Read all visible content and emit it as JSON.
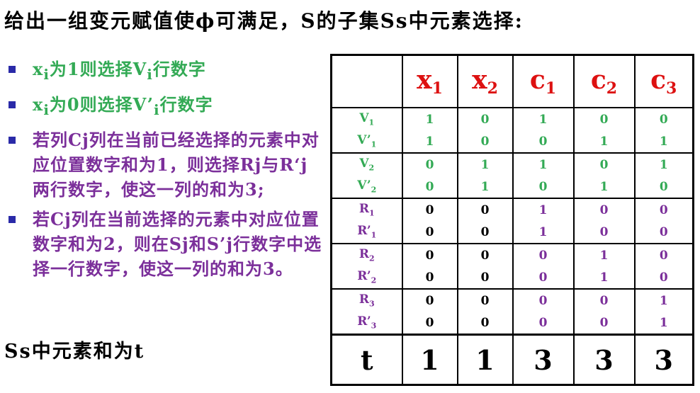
{
  "title": "给出一组变元赋值使ϕ可满足，S的子集Ss中元素选择:",
  "bullets": [
    {
      "pre": "x",
      "sub1": "i",
      "mid": "为1则选择V",
      "sub2": "i",
      "post": "行数字",
      "color": "green"
    },
    {
      "pre": "x",
      "sub1": "i",
      "mid": "为0则选择V’",
      "sub2": "i",
      "post": "行数字",
      "color": "green"
    },
    {
      "text": "若列Cj列在当前已经选择的元素中对应位置数字和为1，则选择Rj与R‘j两行数字，使这一列的和为3;",
      "color": "purple"
    },
    {
      "text": "若Cj列在当前选择的元素中对应位置数字和为2，则在Sj和S’j行数字中选择一行数字，使这一列的和为3。",
      "color": "purple"
    }
  ],
  "summary": "Ss中元素和为t",
  "table": {
    "headers": [
      {
        "base": "x",
        "sub": "1"
      },
      {
        "base": "x",
        "sub": "2"
      },
      {
        "base": "c",
        "sub": "1"
      },
      {
        "base": "c",
        "sub": "2"
      },
      {
        "base": "c",
        "sub": "3"
      }
    ],
    "rows": [
      {
        "label": "V",
        "sub": "1",
        "values": [
          "1",
          "0",
          "1",
          "0",
          "0"
        ]
      },
      {
        "label": "V’",
        "sub": "1",
        "values": [
          "1",
          "0",
          "0",
          "1",
          "1"
        ]
      },
      {
        "label": "V",
        "sub": "2",
        "values": [
          "0",
          "1",
          "1",
          "0",
          "1"
        ]
      },
      {
        "label": "V’",
        "sub": "2",
        "values": [
          "0",
          "1",
          "0",
          "1",
          "0"
        ]
      },
      {
        "label": "R",
        "sub": "1",
        "values": [
          "0",
          "0",
          "1",
          "0",
          "0"
        ]
      },
      {
        "label": "R’",
        "sub": "1",
        "values": [
          "0",
          "0",
          "1",
          "0",
          "0"
        ]
      },
      {
        "label": "R",
        "sub": "2",
        "values": [
          "0",
          "0",
          "0",
          "1",
          "0"
        ]
      },
      {
        "label": "R’",
        "sub": "2",
        "values": [
          "0",
          "0",
          "0",
          "1",
          "0"
        ]
      },
      {
        "label": "R",
        "sub": "3",
        "values": [
          "0",
          "0",
          "0",
          "0",
          "1"
        ]
      },
      {
        "label": "R’",
        "sub": "3",
        "values": [
          "0",
          "0",
          "0",
          "0",
          "1"
        ]
      }
    ],
    "total": {
      "label": "t",
      "values": [
        "1",
        "1",
        "3",
        "3",
        "3"
      ]
    }
  },
  "colors": {
    "header": "#dd1111",
    "green": "#33aa55",
    "purple": "#7b2f9a",
    "bullet_marker": "#2a2aa8"
  }
}
